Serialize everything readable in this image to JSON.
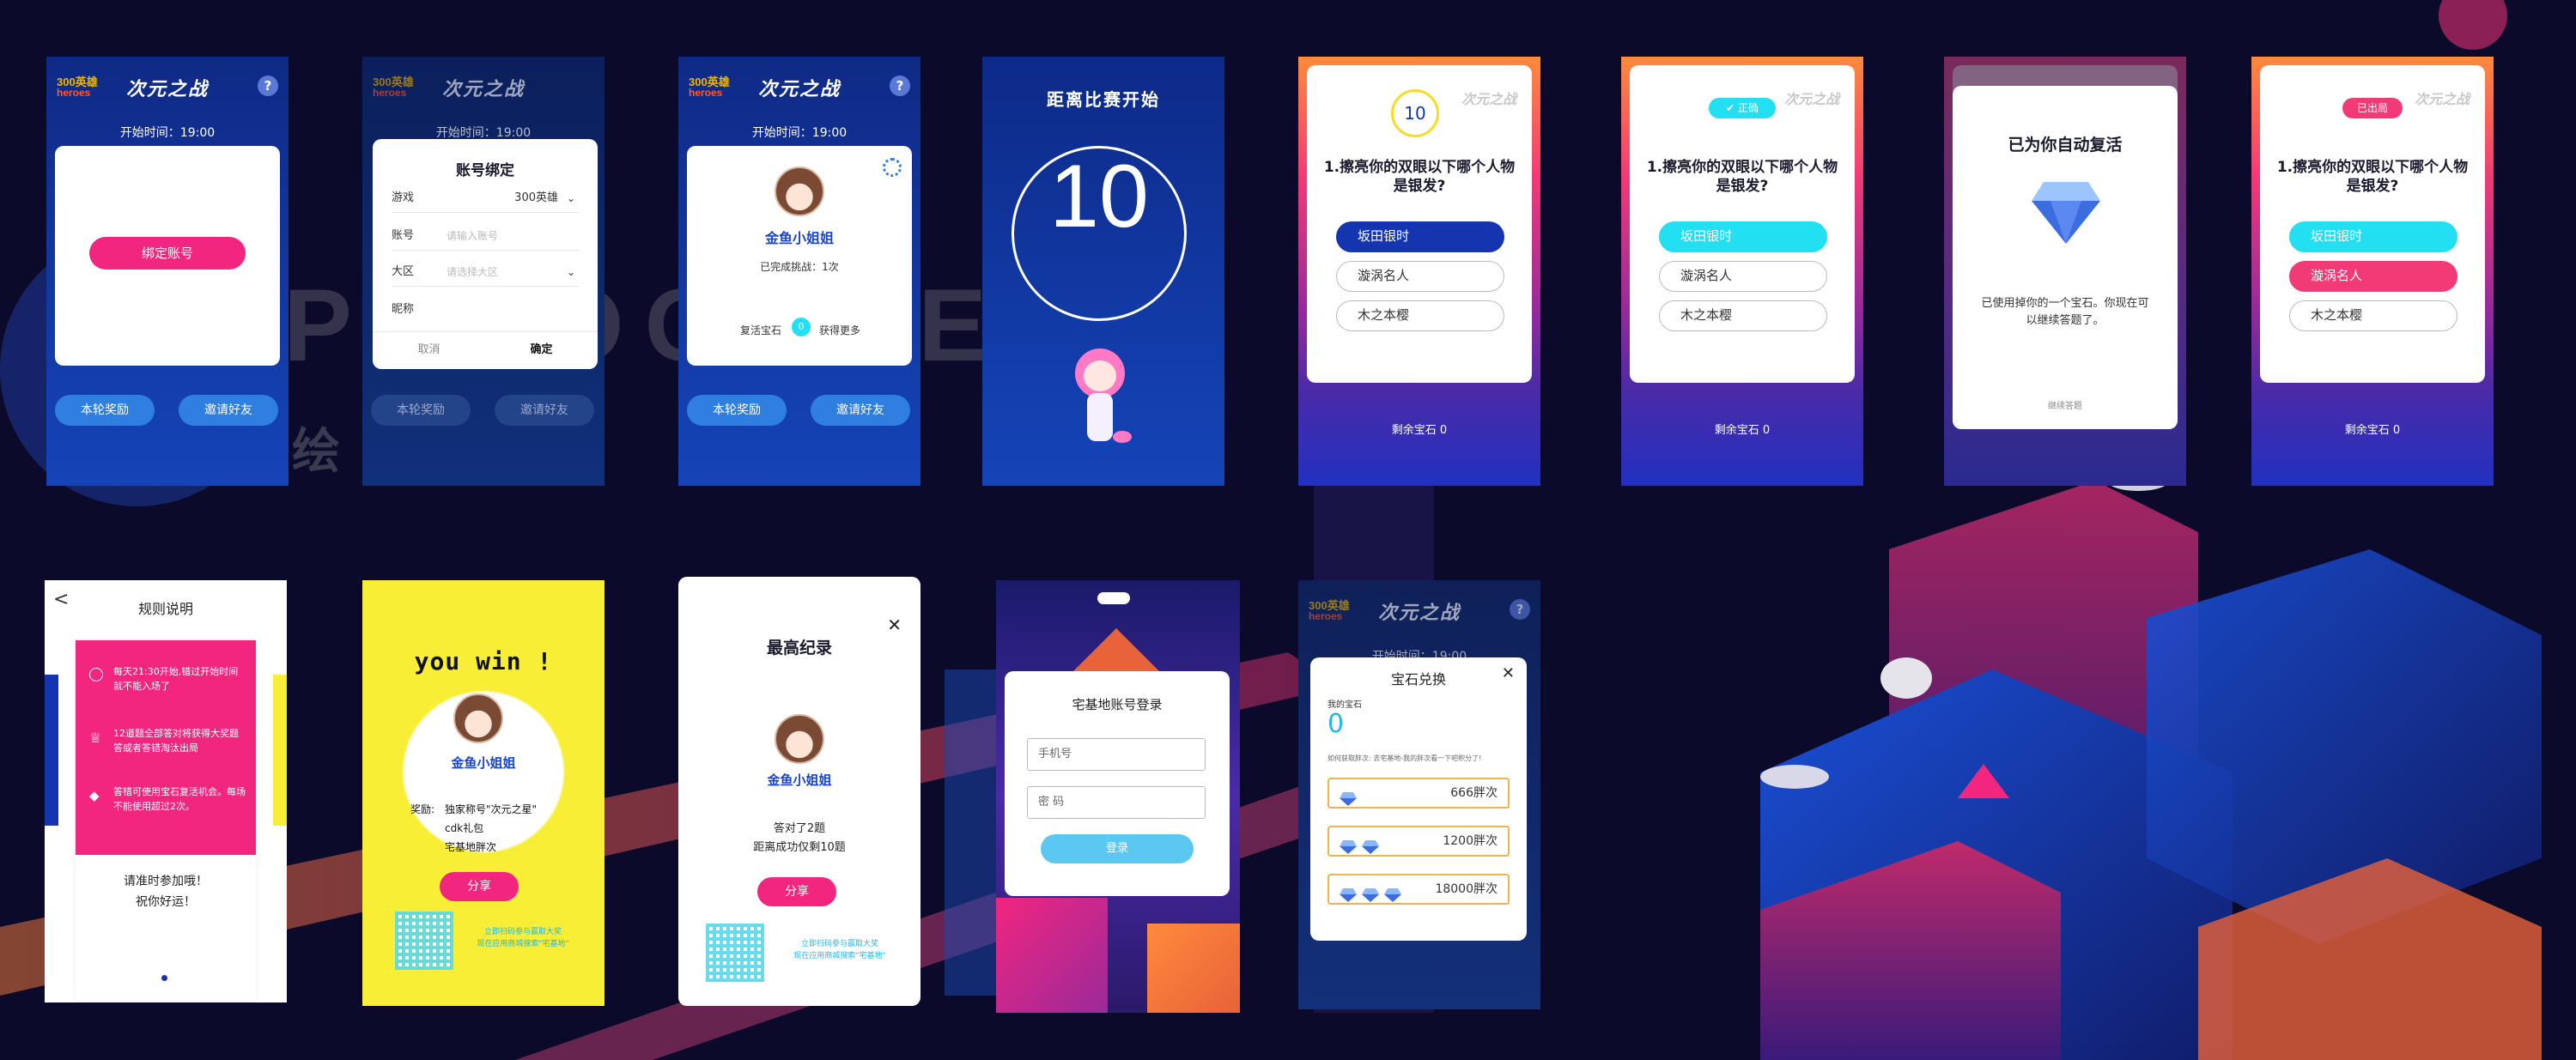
{
  "colors": {
    "bg": "#0c0a2a",
    "blue": "#1544b8",
    "pink": "#f2257f",
    "cyan": "#22e0f2",
    "navy": "#1535b0",
    "yellow": "#f7ee35"
  },
  "background": {
    "watermark": "PSTOOLSET",
    "watermark_cn": "绘"
  },
  "common": {
    "logo_top": "300英雄",
    "logo_bottom": "heroes",
    "game_title": "次元之战",
    "help": "?",
    "start_time": "开始时间：19:00",
    "reward_btn": "本轮奖励",
    "invite_btn": "邀请好友"
  },
  "s1": {
    "bind_btn": "绑定账号"
  },
  "s2": {
    "dialog_title": "账号绑定",
    "game_label": "游戏",
    "game_value": "300英雄",
    "account_label": "账号",
    "account_ph": "请输入账号",
    "region_label": "大区",
    "region_ph": "请选择大区",
    "nick_label": "昵称",
    "cancel": "取消",
    "confirm": "确定"
  },
  "s3": {
    "name": "金鱼小姐姐",
    "challenges": "已完成挑战：1次",
    "revive_gem": "复活宝石",
    "revive_count": "0",
    "get_more": "获得更多"
  },
  "s4": {
    "countdown_label": "距离比赛开始",
    "countdown_value": "10"
  },
  "q1": {
    "timer": "10",
    "question": "1.擦亮你的双眼以下哪个人物是银发?",
    "options": [
      "坂田银时",
      "漩涡名人",
      "木之本樱"
    ],
    "gems": "剩余宝石 0"
  },
  "q2": {
    "badge": "正确",
    "question": "1.擦亮你的双眼以下哪个人物是银发?",
    "options": [
      "坂田银时",
      "漩涡名人",
      "木之本樱"
    ],
    "gems": "剩余宝石 0"
  },
  "q3": {
    "title": "已为你自动复活",
    "text": "已使用掉你的一个宝石。你现在可以继续答题了。",
    "continue": "继续答题"
  },
  "q4": {
    "badge": "已出局",
    "question": "1.擦亮你的双眼以下哪个人物是银发?",
    "options": [
      "坂田银时",
      "漩涡名人",
      "木之本樱"
    ],
    "gems": "剩余宝石 0"
  },
  "r1": {
    "back": "<",
    "title": "规则说明",
    "rules": [
      "每天21:30开始,错过开始时间就不能入场了",
      "12道题全部答对将获得大奖题答或者答错淘汰出局",
      "答错可使用宝石复活机会。每场不能使用超过2次。"
    ],
    "footer_line1": "请准时参加哦！",
    "footer_line2": "祝你好运！"
  },
  "r2": {
    "win": "you win !",
    "name": "金鱼小姐姐",
    "reward_label": "奖励:",
    "reward_lines": [
      "独家称号\"次元之星\"",
      "cdk礼包",
      "宅基地胖次"
    ],
    "share": "分享",
    "qr_text1": "立即扫码参与赢取大奖",
    "qr_text2": "现在应用商城搜索\"宅基地\""
  },
  "r3": {
    "close": "✕",
    "title": "最高纪录",
    "name": "金鱼小姐姐",
    "line1": "答对了2题",
    "line2": "距离成功仅剩10题",
    "share": "分享",
    "qr_text1": "立即扫码参与赢取大奖",
    "qr_text2": "现在应用商城搜索\"宅基地\""
  },
  "r4": {
    "title": "宅基地账号登录",
    "phone_ph": "手机号",
    "pwd_ph": "密  码",
    "login": "登录"
  },
  "r5": {
    "title": "宝石兑换",
    "close": "✕",
    "my_gems_label": "我的宝石",
    "my_gems": "0",
    "hint": "如何获取胖次: 去宅基地-我的胖次看一下吧积分了!",
    "rows": [
      "666胖次",
      "1200胖次",
      "18000胖次"
    ],
    "under_start": "开始时间：19:00"
  }
}
